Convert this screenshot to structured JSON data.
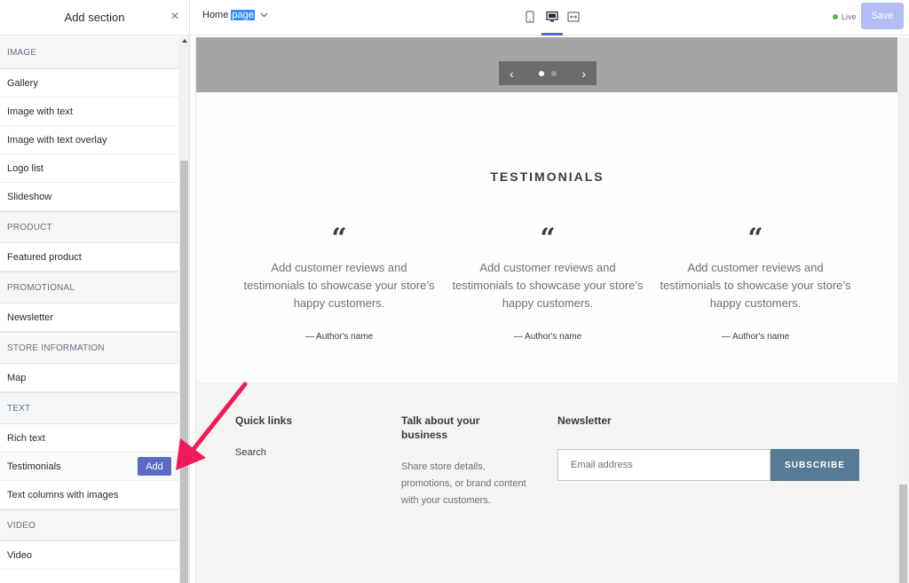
{
  "sidebar": {
    "title": "Add section",
    "close_icon": "×",
    "add_label": "Add",
    "categories": [
      {
        "label": "IMAGE"
      },
      {
        "label": "PRODUCT"
      },
      {
        "label": "PROMOTIONAL"
      },
      {
        "label": "STORE INFORMATION"
      },
      {
        "label": "TEXT"
      },
      {
        "label": "VIDEO"
      }
    ],
    "items": [
      {
        "label": "Gallery"
      },
      {
        "label": "Image with text"
      },
      {
        "label": "Image with text overlay"
      },
      {
        "label": "Logo list"
      },
      {
        "label": "Slideshow"
      },
      {
        "label": "Featured product"
      },
      {
        "label": "Newsletter"
      },
      {
        "label": "Map"
      },
      {
        "label": "Rich text"
      },
      {
        "label": "Testimonials"
      },
      {
        "label": "Text columns with images"
      },
      {
        "label": "Video"
      }
    ]
  },
  "topbar": {
    "page_prefix": "Home ",
    "page_selected": "page",
    "live_label": "Live",
    "save_label": "Save",
    "live_color": "#50b83c",
    "accent_color": "#5c6ac4"
  },
  "preview": {
    "slideshow": {
      "prev_icon": "‹",
      "next_icon": "›",
      "active_slide": 1,
      "slide_count": 2
    },
    "testimonials": {
      "title": "TESTIMONIALS",
      "items": [
        {
          "quote": "“",
          "text": "Add customer reviews and testimonials to showcase your store’s happy customers.",
          "author": "— Author's name"
        },
        {
          "quote": "“",
          "text": "Add customer reviews and testimonials to showcase your store’s happy customers.",
          "author": "— Author's name"
        },
        {
          "quote": "“",
          "text": "Add customer reviews and testimonials to showcase your store’s happy customers.",
          "author": "— Author's name"
        }
      ]
    },
    "footer": {
      "quick_links_title": "Quick links",
      "quick_links": [
        "Search"
      ],
      "about_title": "Talk about your business",
      "about_text": "Share store details, promotions, or brand content with your customers.",
      "newsletter_title": "Newsletter",
      "email_placeholder": "Email address",
      "subscribe_label": "SUBSCRIBE",
      "subscribe_color": "#557b97"
    }
  },
  "annotation": {
    "icon": "arrow-pointer-icon",
    "color": "#f0195b"
  }
}
